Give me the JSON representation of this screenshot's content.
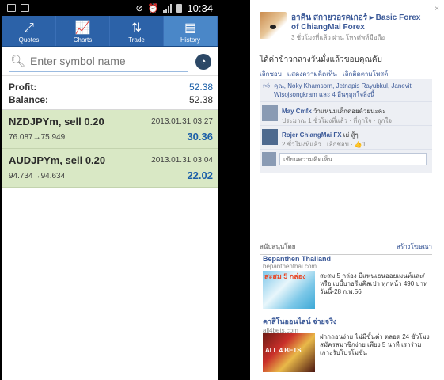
{
  "phone": {
    "status": {
      "time": "10:34"
    },
    "tabs": [
      {
        "label": "Quotes",
        "icon": "arrows-icon"
      },
      {
        "label": "Charts",
        "icon": "line-chart-icon"
      },
      {
        "label": "Trade",
        "icon": "trade-icon"
      },
      {
        "label": "History",
        "icon": "history-icon",
        "active": true
      }
    ],
    "search": {
      "placeholder": "Enter symbol name"
    },
    "summary": {
      "profit_label": "Profit:",
      "profit_value": "52.38",
      "balance_label": "Balance:",
      "balance_value": "52.38"
    },
    "trades": [
      {
        "symbol": "NZDJPYm, sell 0.20",
        "date": "2013.01.31 03:27",
        "prices": "76.087→75.949",
        "profit": "30.36"
      },
      {
        "symbol": "AUDJPYm, sell 0.20",
        "date": "2013.01.31 03:04",
        "prices": "94.734→94.634",
        "profit": "22.02"
      }
    ]
  },
  "fb": {
    "post": {
      "author": "อาคิน สกายวอรคเกอร์ ▸ Basic Forex of ChiangMai Forex",
      "meta": "3 ชั่วโมงที่แล้ว ผ่าน โทรศัพท์มือถือ",
      "close": "×",
      "status": "ได้ค่าข้าวกลางวันมั่งแล้วขอบคุณคับ",
      "actions": [
        "เลิกชอบ",
        "แสดงความคิดเห็น",
        "เลิกติดตามโพสต์"
      ],
      "likes_text": "คุณ, Noky Khamsorn, Jetnapis Rayubkul, Janevit Wisojsongkram และ 4 อื่นๆถูกใจสิ่งนี้",
      "comments": [
        {
          "name": "May Cmfx",
          "text": "ว้าแหนมเด็กดอยด้วยนะคะ",
          "meta": "ประมาณ 1 ชั่วโมงที่แล้ว · ที่ถูกใจ · ถูกใจ"
        },
        {
          "name": "Rojer ChiangMai FX",
          "text": "เย่ สู้ๆ",
          "meta": "2 ชั่วโมงที่แล้ว · เลิกชอบ · 👍1"
        }
      ],
      "write_placeholder": "เขียนความคิดเห็น"
    },
    "sponsored": {
      "label": "สนับสนุนโดย",
      "create_ad": "สร้างโฆษณา",
      "ads": [
        {
          "title": "Bepanthen Thailand",
          "url": "bepanthenthai.com",
          "badge": "สะสม 5 กล่อง",
          "desc": "สะสม 5 กล่อง บีแพนเธนออยเมนท์และ/หรือ เบบี้บาธรีมคิสเปา ทุกหน้า 490 บาท วันนี้-28 ก.พ.56"
        },
        {
          "title": "คาสิโนออนไลน์ จ่ายจริง",
          "url": "all4bets.com",
          "badge": "ALL 4 BETS",
          "desc": "ฝากถอนง่าย ไม่มีขั้นต่ำ ตลอด 24 ชั่วโมง สมัครสมาชิกง่าย เพียง 5 นาที เราร่วมเกาะรับโปรโมชั่น"
        }
      ]
    }
  }
}
